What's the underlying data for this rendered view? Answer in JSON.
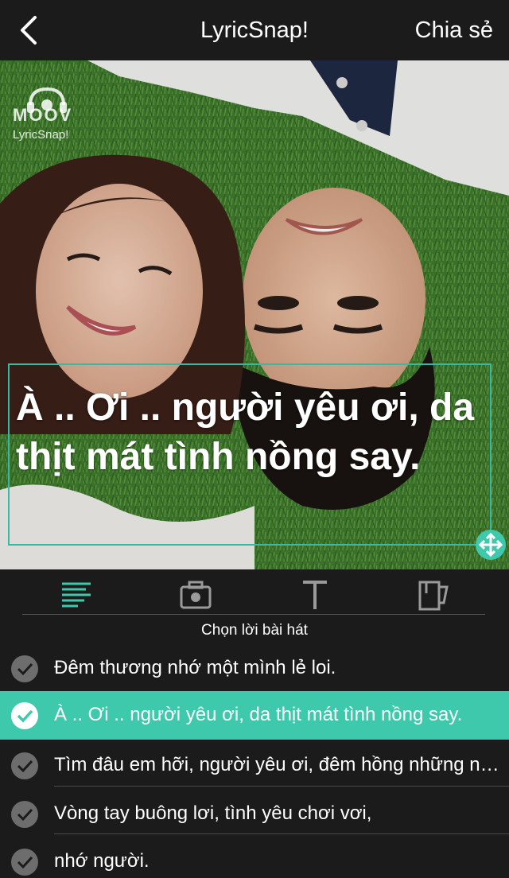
{
  "header": {
    "title": "LyricSnap!",
    "share_label": "Chia sẻ"
  },
  "photo": {
    "logo_text": "MOOV",
    "logo_sub": "LyricSnap!",
    "lyric_overlay": "À .. Ơi .. người yêu ơi, da thịt mát tình nồng say."
  },
  "toolbar": {
    "tools": [
      "lyrics-list-icon",
      "camera-icon",
      "text-icon",
      "mug-icon"
    ]
  },
  "section_label": "Chọn lời bài hát",
  "lyrics": [
    {
      "text": "Đêm thương nhớ một mình lẻ loi.",
      "selected": false
    },
    {
      "text": "À .. Ơi .. người yêu ơi, da thịt mát tình nồng say.",
      "selected": true
    },
    {
      "text": "Tìm đâu em hỡi, người yêu ơi, đêm hồng những ngày",
      "selected": false
    },
    {
      "text": "Vòng tay buông lơi, tình yêu chơi vơi,",
      "selected": false
    },
    {
      "text": "nhớ người.",
      "selected": false
    }
  ],
  "colors": {
    "accent": "#3ec9ad",
    "background": "#1b1b1b"
  }
}
